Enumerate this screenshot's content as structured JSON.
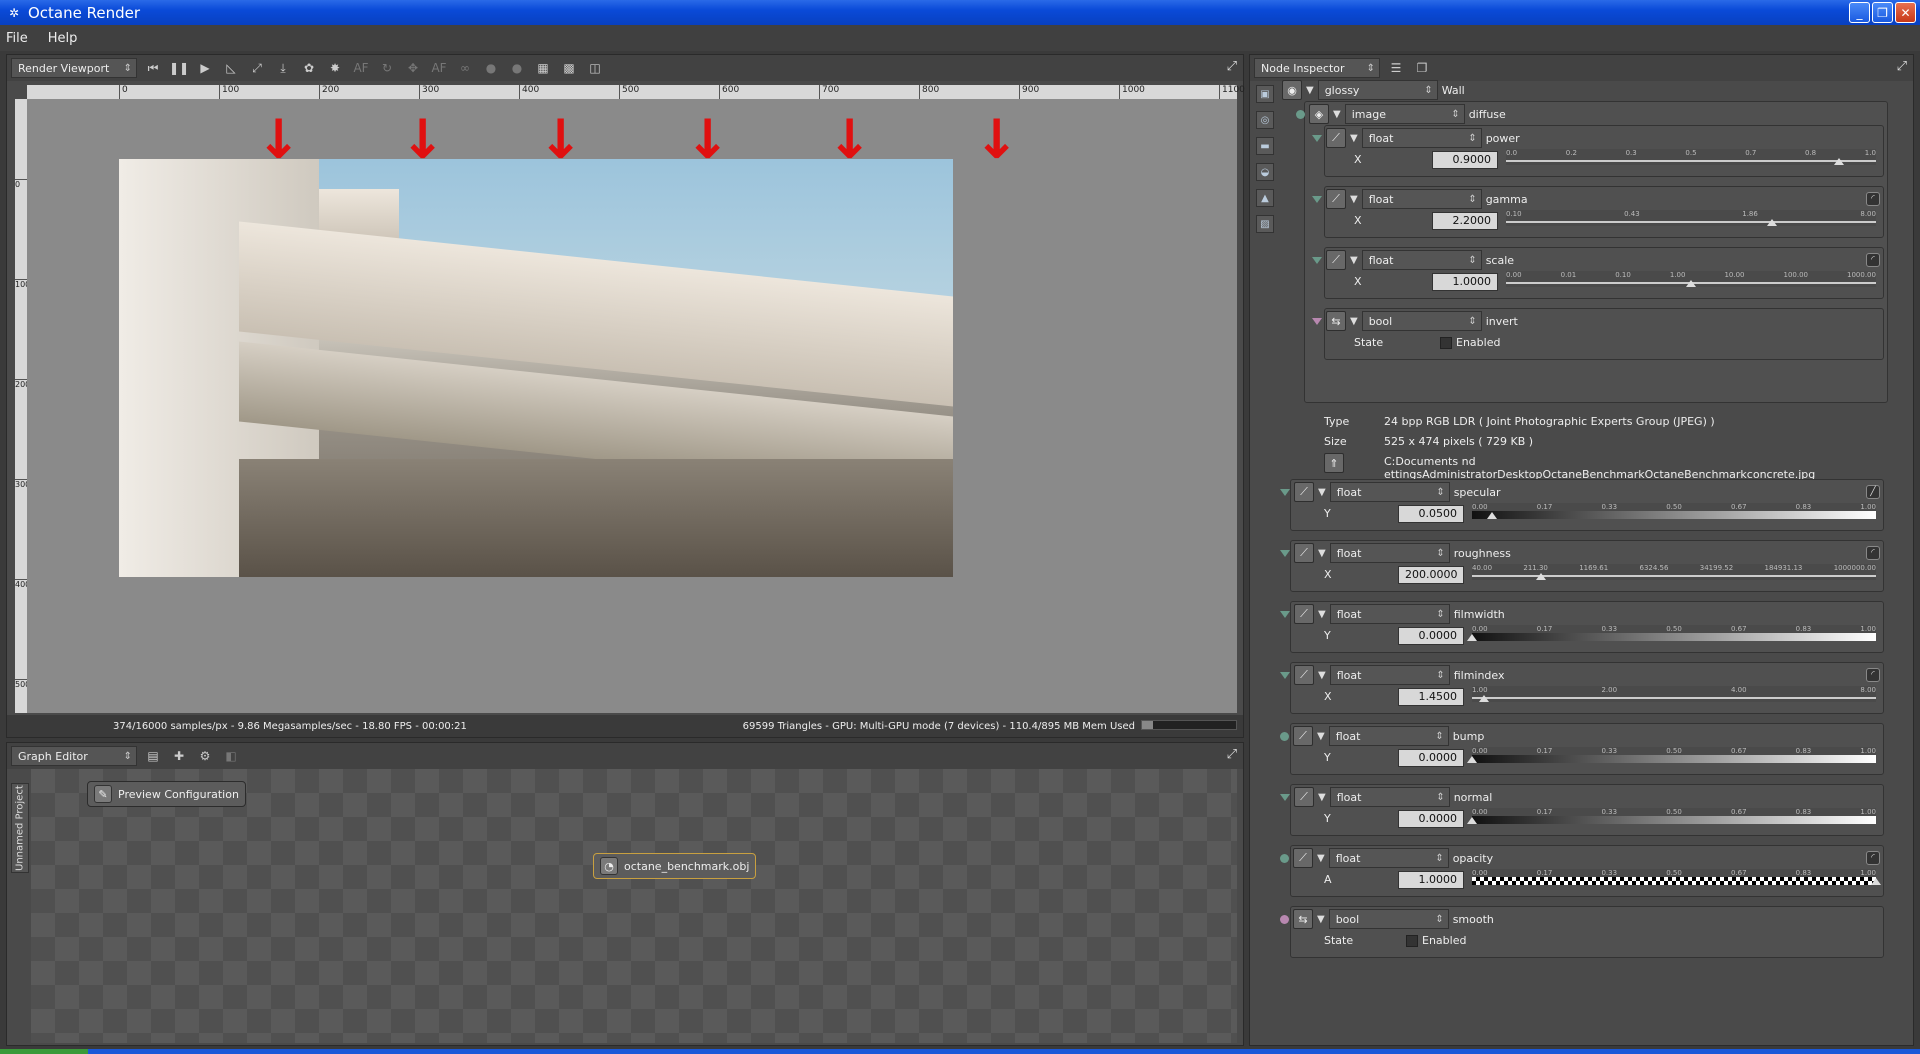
{
  "window": {
    "title": "Octane Render"
  },
  "menu": [
    "File",
    "Help"
  ],
  "viewport": {
    "panel_label": "Render Viewport",
    "ruler_h": [
      "0",
      "100",
      "200",
      "300",
      "400",
      "500",
      "600",
      "700",
      "800",
      "900",
      "1000",
      "1100"
    ],
    "ruler_v": [
      "0",
      "100",
      "200",
      "300",
      "400",
      "500"
    ],
    "status_left": "374/16000 samples/px - 9.86 Megasamples/sec - 18.80 FPS - 00:00:21",
    "status_right": "69599 Triangles - GPU: Multi-GPU mode (7 devices) - 110.4/895 MB Mem Used"
  },
  "graph": {
    "panel_label": "Graph Editor",
    "side_tab": "Unnamed Project",
    "node_preview": "Preview Configuration",
    "node_obj": "octane_benchmark.obj"
  },
  "inspector": {
    "panel_label": "Node Inspector",
    "root": {
      "type": "glossy",
      "name": "Wall"
    },
    "diffuse": {
      "type": "image",
      "name": "diffuse"
    },
    "sub": [
      {
        "type": "float",
        "name": "power",
        "axis": "X",
        "value": "0.9000",
        "ticks": [
          "0.0",
          "0.2",
          "0.3",
          "0.5",
          "0.7",
          "0.8",
          "1.0"
        ],
        "pos": 0.9
      },
      {
        "type": "float",
        "name": "gamma",
        "axis": "X",
        "value": "2.2000",
        "ticks": [
          "0.10",
          "0.43",
          "1.86",
          "8.00"
        ],
        "pos": 0.72
      },
      {
        "type": "float",
        "name": "scale",
        "axis": "X",
        "value": "1.0000",
        "ticks": [
          "0.00",
          "0.01",
          "0.10",
          "1.00",
          "10.00",
          "100.00",
          "1000.00"
        ],
        "pos": 0.5
      }
    ],
    "invert": {
      "type": "bool",
      "name": "invert",
      "state_label": "State",
      "enabled_label": "Enabled"
    },
    "image_info": {
      "type_label": "Type",
      "type_value": "24 bpp RGB LDR ( Joint Photographic Experts Group (JPEG) )",
      "size_label": "Size",
      "size_value": "525 x 474 pixels ( 729 KB )",
      "path": "C:Documents  nd   ettingsAdministratorDesktopOctaneBenchmarkOctaneBenchmarkconcrete.jpg"
    },
    "params": [
      {
        "type": "float",
        "name": "specular",
        "axis": "Y",
        "value": "0.0500",
        "kind": "grad",
        "ticks": [
          "0.00",
          "0.17",
          "0.33",
          "0.50",
          "0.67",
          "0.83",
          "1.00"
        ],
        "pos": 0.05
      },
      {
        "type": "float",
        "name": "roughness",
        "axis": "X",
        "value": "200.0000",
        "kind": "slider",
        "ticks": [
          "40.00",
          "211.30",
          "1169.61",
          "6324.56",
          "34199.52",
          "184931.13",
          "1000000.00"
        ],
        "pos": 0.17
      },
      {
        "type": "float",
        "name": "filmwidth",
        "axis": "Y",
        "value": "0.0000",
        "kind": "grad",
        "ticks": [
          "0.00",
          "0.17",
          "0.33",
          "0.50",
          "0.67",
          "0.83",
          "1.00"
        ],
        "pos": 0.0
      },
      {
        "type": "float",
        "name": "filmindex",
        "axis": "X",
        "value": "1.4500",
        "kind": "slider",
        "ticks": [
          "1.00",
          "2.00",
          "4.00",
          "8.00"
        ],
        "pos": 0.03
      },
      {
        "type": "float",
        "name": "bump",
        "axis": "Y",
        "value": "0.0000",
        "kind": "grad",
        "ticks": [
          "0.00",
          "0.17",
          "0.33",
          "0.50",
          "0.67",
          "0.83",
          "1.00"
        ],
        "pos": 0.0
      },
      {
        "type": "float",
        "name": "normal",
        "axis": "Y",
        "value": "0.0000",
        "kind": "grad",
        "ticks": [
          "0.00",
          "0.17",
          "0.33",
          "0.50",
          "0.67",
          "0.83",
          "1.00"
        ],
        "pos": 0.0
      },
      {
        "type": "float",
        "name": "opacity",
        "axis": "A",
        "value": "1.0000",
        "kind": "checker",
        "ticks": [
          "0.00",
          "0.17",
          "0.33",
          "0.50",
          "0.67",
          "0.83",
          "1.00"
        ],
        "pos": 1.0
      }
    ],
    "smooth": {
      "type": "bool",
      "name": "smooth",
      "state_label": "State",
      "enabled_label": "Enabled"
    }
  }
}
